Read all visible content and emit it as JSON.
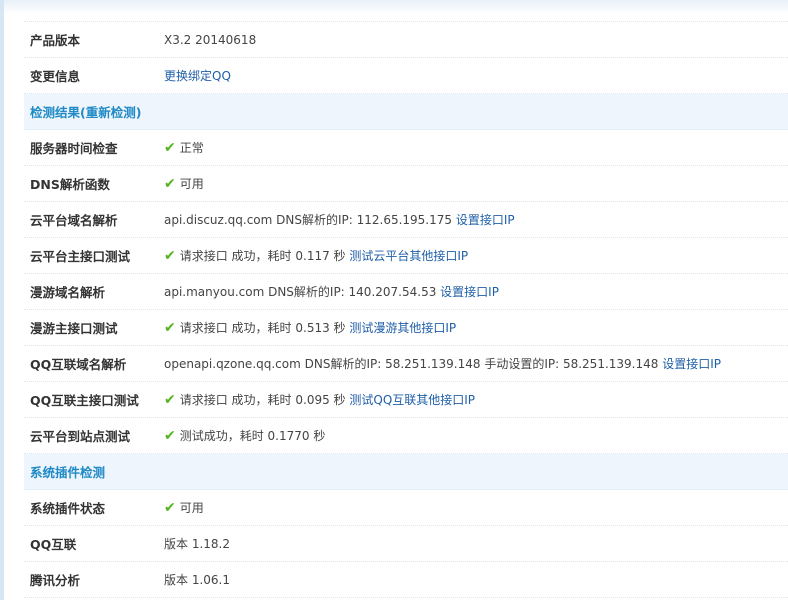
{
  "rows_top": [
    {
      "label": "",
      "value": ""
    },
    {
      "label": "产品版本",
      "value": "X3.2 20140618"
    },
    {
      "label": "变更信息",
      "link": "更换绑定QQ"
    }
  ],
  "section1": {
    "title": "检测结果",
    "link": "(重新检测)"
  },
  "checks": [
    {
      "label": "服务器时间检查",
      "ok": true,
      "value": "正常"
    },
    {
      "label": "DNS解析函数",
      "ok": true,
      "value": "可用"
    },
    {
      "label": "云平台域名解析",
      "ok": false,
      "value": "api.discuz.qq.com DNS解析的IP: 112.65.195.175",
      "link": "设置接口IP"
    },
    {
      "label": "云平台主接口测试",
      "ok": true,
      "value": "请求接口 成功，耗时 0.117 秒",
      "link": "测试云平台其他接口IP"
    },
    {
      "label": "漫游域名解析",
      "ok": false,
      "value": "api.manyou.com DNS解析的IP: 140.207.54.53",
      "link": "设置接口IP"
    },
    {
      "label": "漫游主接口测试",
      "ok": true,
      "value": "请求接口 成功，耗时 0.513 秒",
      "link": "测试漫游其他接口IP"
    },
    {
      "label": "QQ互联域名解析",
      "ok": false,
      "value": "openapi.qzone.qq.com DNS解析的IP: 58.251.139.148 手动设置的IP: 58.251.139.148",
      "link": "设置接口IP"
    },
    {
      "label": "QQ互联主接口测试",
      "ok": true,
      "value": "请求接口 成功，耗时 0.095 秒",
      "link": "测试QQ互联其他接口IP"
    },
    {
      "label": "云平台到站点测试",
      "ok": true,
      "value": "测试成功，耗时 0.1770 秒"
    }
  ],
  "section2": {
    "title": "系统插件检测"
  },
  "plugins": [
    {
      "label": "系统插件状态",
      "ok": true,
      "value": "可用"
    },
    {
      "label": "QQ互联",
      "ok": false,
      "value": "版本 1.18.2"
    },
    {
      "label": "腾讯分析",
      "ok": false,
      "value": "版本 1.06.1"
    }
  ],
  "icons": {
    "ok": "checkmark-icon"
  }
}
